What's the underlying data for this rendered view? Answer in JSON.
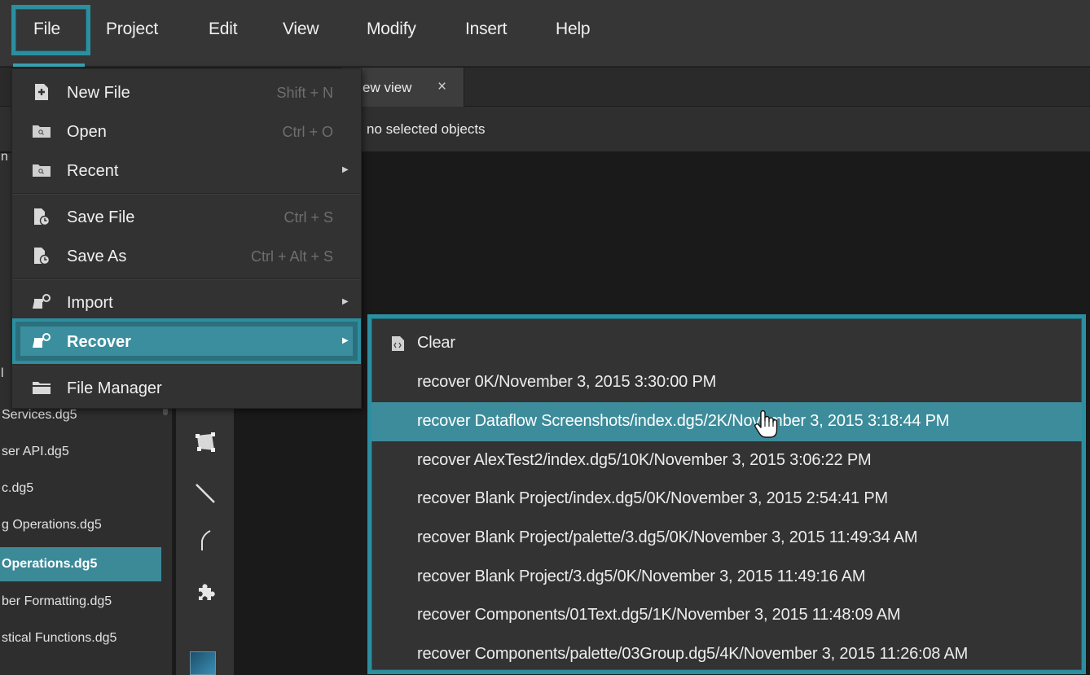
{
  "menubar": {
    "items": [
      "File",
      "Project",
      "Edit",
      "View",
      "Modify",
      "Insert",
      "Help"
    ]
  },
  "document_tab": {
    "label": "ew view",
    "close_glyph": "×"
  },
  "status": {
    "text": "no selected objects"
  },
  "file_menu": {
    "items": [
      {
        "label": "New File",
        "shortcut": "Shift + N",
        "icon": "new-file-icon"
      },
      {
        "label": "Open",
        "shortcut": "Ctrl + O",
        "icon": "folder-icon"
      },
      {
        "label": "Recent",
        "shortcut": "",
        "icon": "folder-icon",
        "submenu": true
      },
      {
        "label": "Save File",
        "shortcut": "Ctrl + S",
        "icon": "save-file-icon"
      },
      {
        "label": "Save As",
        "shortcut": "Ctrl + Alt + S",
        "icon": "save-file-icon"
      },
      {
        "label": "Import",
        "shortcut": "",
        "icon": "import-icon",
        "submenu": true
      },
      {
        "label": "Recover",
        "shortcut": "",
        "icon": "import-icon",
        "submenu": true,
        "highlighted": true
      },
      {
        "label": "File Manager",
        "shortcut": "",
        "icon": "folder-icon"
      }
    ]
  },
  "recover_submenu": {
    "items": [
      {
        "label": "Clear",
        "icon": "code-file-icon"
      },
      {
        "label": "recover 0K/November 3, 2015 3:30:00 PM"
      },
      {
        "label": "recover Dataflow Screenshots/index.dg5/2K/November 3, 2015 3:18:44 PM",
        "selected": true
      },
      {
        "label": "recover AlexTest2/index.dg5/10K/November 3, 2015 3:06:22 PM"
      },
      {
        "label": "recover Blank Project/index.dg5/0K/November 3, 2015 2:54:41 PM"
      },
      {
        "label": "recover Blank Project/palette/3.dg5/0K/November 3, 2015 11:49:34 AM"
      },
      {
        "label": "recover Blank Project/3.dg5/0K/November 3, 2015 11:49:16 AM"
      },
      {
        "label": "recover Components/01Text.dg5/1K/November 3, 2015 11:48:09 AM"
      },
      {
        "label": "recover Components/palette/03Group.dg5/4K/November 3, 2015 11:26:08 AM"
      }
    ]
  },
  "project_list": {
    "edge_chars": [
      "n",
      "l"
    ],
    "items": [
      {
        "label": "Services.dg5"
      },
      {
        "label": "ser API.dg5"
      },
      {
        "label": "c.dg5"
      },
      {
        "label": "g Operations.dg5"
      },
      {
        "label": "Operations.dg5",
        "active": true
      },
      {
        "label": "ber Formatting.dg5"
      },
      {
        "label": "stical Functions.dg5"
      }
    ]
  },
  "colors": {
    "accent": "#2b8fa0",
    "selection": "#3d8c9b",
    "menu_bg": "#323232",
    "menubar_bg": "#363636"
  }
}
